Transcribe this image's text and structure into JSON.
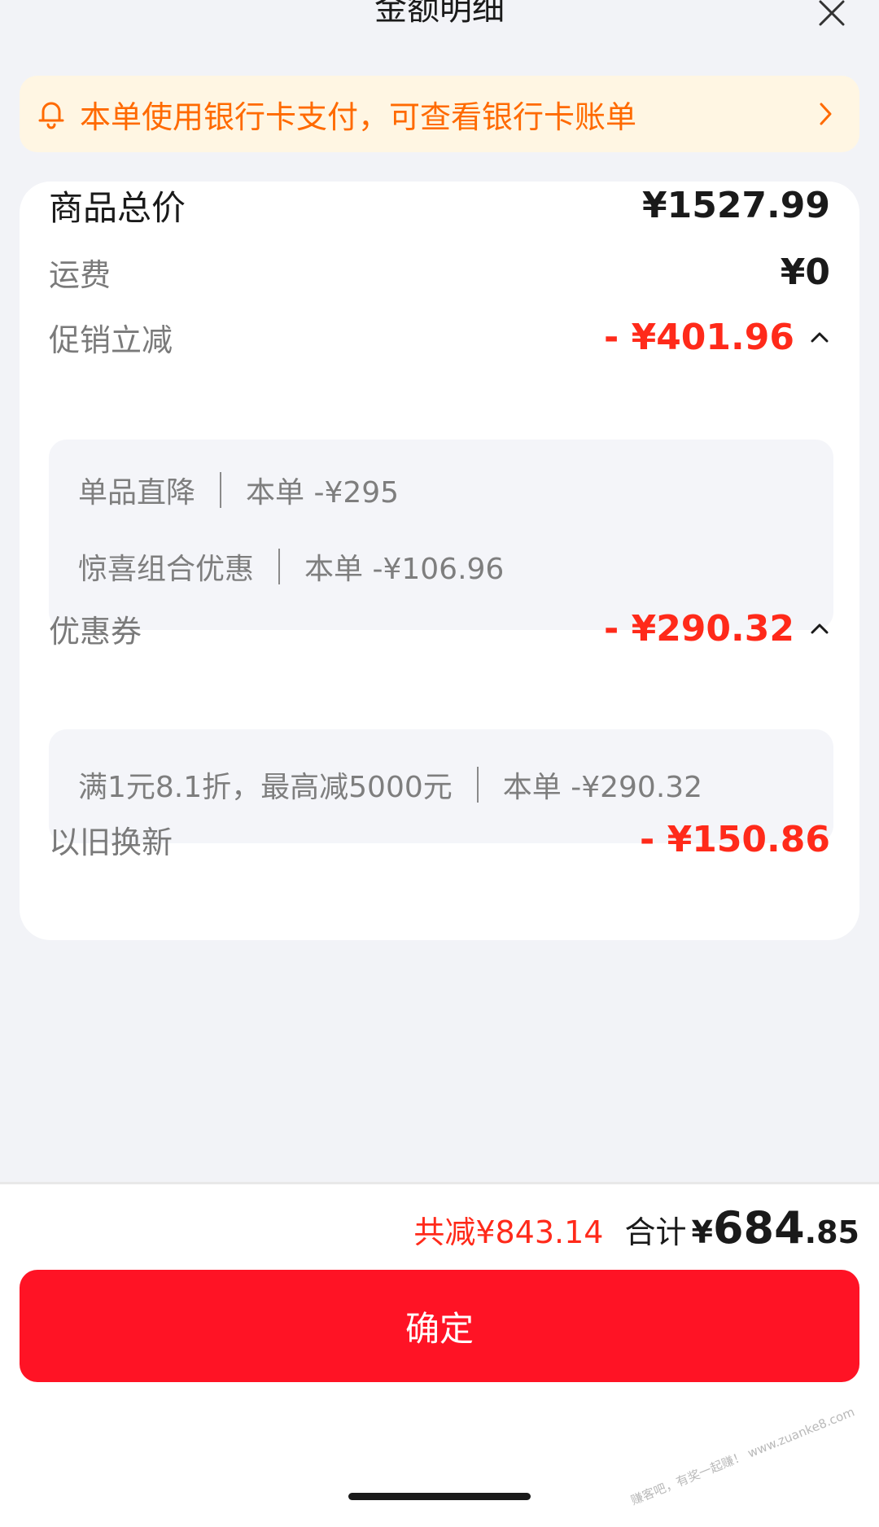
{
  "header": {
    "title": "金额明细"
  },
  "notice": {
    "text": "本单使用银行卡支付，可查看银行卡账单"
  },
  "breakdown": {
    "goods_total": {
      "label": "商品总价",
      "amount": "¥1527.99"
    },
    "shipping": {
      "label": "运费",
      "amount": "¥0"
    },
    "promotion": {
      "label": "促销立减",
      "amount": "- ¥401.96",
      "details": [
        {
          "name": "单品直降",
          "value": "本单 -¥295"
        },
        {
          "name": "惊喜组合优惠",
          "value": "本单 -¥106.96"
        }
      ]
    },
    "coupon": {
      "label": "优惠券",
      "amount": "- ¥290.32",
      "details": [
        {
          "name": "满1元8.1折，最高减5000元",
          "value": "本单 -¥290.32"
        }
      ]
    },
    "trade_in": {
      "label": "以旧换新",
      "amount": "- ¥150.86"
    }
  },
  "summary": {
    "saved": "共减¥843.14",
    "total_label": "合计",
    "currency": "¥",
    "total_int": "684",
    "total_dec": ".85"
  },
  "confirm_label": "确定",
  "watermark": "赚客吧，有奖一起赚！ www.zuanke8.com",
  "colors": {
    "accent": "#ff1325",
    "discount": "#ff2a1a",
    "notice_text": "#ff6a00",
    "notice_bg": "#fff6e3"
  }
}
